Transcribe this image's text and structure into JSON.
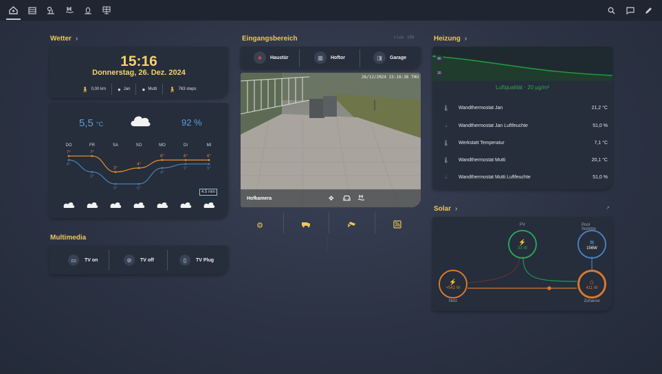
{
  "nav": {
    "left_icons": [
      "home-icon",
      "list-icon",
      "tree-icon",
      "pool-icon",
      "plant-icon",
      "solar-panel-icon"
    ],
    "right_icons": [
      "search-icon",
      "chat-icon",
      "edit-icon"
    ]
  },
  "weather": {
    "title": "Wetter",
    "time": "15:16",
    "date": "Donnerstag, 26. Dez. 2024",
    "stats": [
      {
        "icon": "walk-icon",
        "value": "0,00 km"
      },
      {
        "icon": "person-icon",
        "value": "Jan"
      },
      {
        "icon": "person-icon",
        "value": "Mutti"
      },
      {
        "icon": "walk-icon",
        "value": "763 steps"
      }
    ],
    "temperature": "5,5",
    "temperature_unit": "°C",
    "humidity": "92 %",
    "zoom_badge": "4.5 mm",
    "forecast": {
      "days": [
        "DO",
        "FR",
        "SA",
        "SO",
        "MO",
        "DI",
        "MI"
      ],
      "highs": [
        "7°",
        "7°",
        "3°",
        "4°",
        "6°",
        "6°",
        "6°"
      ],
      "lows": [
        "6°",
        "3°",
        "0°",
        "0°",
        "4°",
        "5°",
        "5°"
      ],
      "high_values": [
        7,
        7,
        3,
        4,
        6,
        6,
        6
      ],
      "low_values": [
        6,
        3,
        0,
        0,
        4,
        5,
        5
      ]
    }
  },
  "multimedia": {
    "title": "Multimedia",
    "buttons": [
      {
        "label": "TV on",
        "icon": "tv-icon"
      },
      {
        "label": "TV off",
        "icon": "tv-off-icon"
      },
      {
        "label": "TV Plug",
        "icon": "plug-icon"
      }
    ]
  },
  "entrance": {
    "title": "Eingangsbereich",
    "lux": "Lux · 156",
    "doors": [
      {
        "label": "Haustür",
        "icon": "door-lock-icon",
        "color": "#e04848"
      },
      {
        "label": "Hoftor",
        "icon": "gate-icon",
        "color": "#9aa3b2"
      },
      {
        "label": "Garage",
        "icon": "garage-icon",
        "color": "#9aa3b2"
      }
    ],
    "camera": {
      "title": "Hofkamera",
      "timestamp": "26/12/2024 15:16:36 THU"
    },
    "actions": [
      "gear-icon",
      "truck-icon",
      "cctv-icon",
      "rss-icon"
    ]
  },
  "heating": {
    "title": "Heizung",
    "graph_labels": [
      "86",
      "20"
    ],
    "air_quality": "Luftqualität · 20 µg/m³",
    "rows": [
      {
        "icon": "thermometer-icon",
        "label": "Wandthermostat Jan",
        "value": "21,2 °C"
      },
      {
        "icon": "droplet-icon",
        "label": "Wandthermostat Jan Luftfeuchte",
        "value": "51,0 %"
      },
      {
        "icon": "thermometer-icon",
        "label": "Werkstatt Temperatur",
        "value": "7,1 °C"
      },
      {
        "icon": "thermometer-icon",
        "label": "Wandthermostat Mutti",
        "value": "20,1 °C"
      },
      {
        "icon": "droplet-icon",
        "label": "Wandthermostat Mutti Luftfeuchte",
        "value": "51,0 %"
      }
    ]
  },
  "solar": {
    "title": "Solar",
    "nodes": {
      "pv": {
        "label": "PV",
        "value": "33 W"
      },
      "pool": {
        "label": "Pool Summe",
        "value": "156W"
      },
      "grid": {
        "label": "Netz",
        "value": "+542 W"
      },
      "home": {
        "label": "Zuhause",
        "value": "411 W"
      }
    }
  }
}
